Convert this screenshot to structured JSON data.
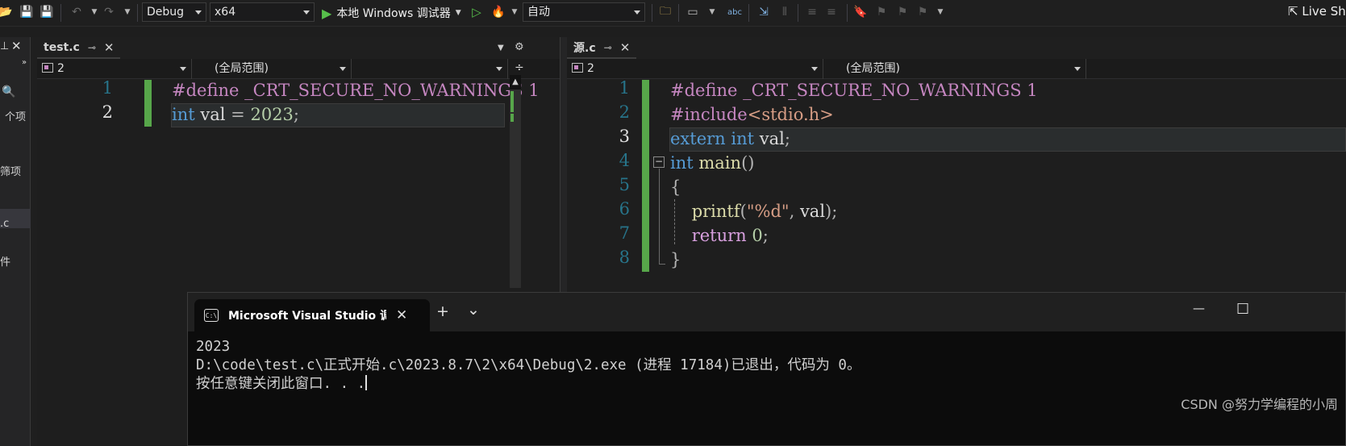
{
  "toolbar": {
    "configuration": "Debug",
    "platform": "x64",
    "run_label": "本地 Windows 调试器",
    "solution_config": "自动",
    "live_share": "Live Sh"
  },
  "sidebar": {
    "item1": "个项",
    "item2": "筛项",
    "item3": ".c",
    "item4": "件"
  },
  "left_editor": {
    "tab_title": "test.c",
    "nav_project": "2",
    "nav_scope": "(全局范围)",
    "lines": [
      "1",
      "2"
    ],
    "code": {
      "l1_directive": "#define",
      "l1_name": "_CRT_SECURE_NO_WARNINGS",
      "l1_value": "1",
      "l2_type": "int",
      "l2_var": "val",
      "l2_eq": "=",
      "l2_value": "2023",
      "l2_semi": ";"
    }
  },
  "right_editor": {
    "tab_title": "源.c",
    "nav_project": "2",
    "nav_scope": "(全局范围)",
    "lines": [
      "1",
      "2",
      "3",
      "4",
      "5",
      "6",
      "7",
      "8"
    ],
    "code": {
      "l1_directive": "#define",
      "l1_name": "_CRT_SECURE_NO_WARNINGS",
      "l1_value": "1",
      "l2_directive": "#include",
      "l2_header": "<stdio.h>",
      "l3_extern": "extern",
      "l3_type": "int",
      "l3_var": "val",
      "l3_semi": ";",
      "l4_type": "int",
      "l4_fn": "main",
      "l4_parens": "()",
      "l5_brace": "{",
      "l6_fn": "printf",
      "l6_open": "(",
      "l6_str": "\"%d\"",
      "l6_comma": ",",
      "l6_arg": "val",
      "l6_close": ");",
      "l7_kw": "return",
      "l7_value": "0",
      "l7_semi": ";",
      "l8_brace": "}"
    }
  },
  "console": {
    "title": "Microsoft Visual Studio 调试控",
    "icon_text": "C:\\",
    "new_tab": "+",
    "dropdown": "⌄",
    "minimize": "—",
    "maximize": "☐",
    "output_line1": "2023",
    "output_line2": "D:\\code\\test.c\\正式开始.c\\2023.8.7\\2\\x64\\Debug\\2.exe (进程 17184)已退出，代码为 0。",
    "output_line3": "按任意键关闭此窗口. . ."
  },
  "watermark": "CSDN @努力学编程的小周",
  "colors": {
    "keyword": "#569cd6",
    "macro": "#c586c0",
    "string": "#d69d85",
    "number": "#b5cea8",
    "function": "#dcdcaa",
    "change_bar": "#57a64a"
  }
}
